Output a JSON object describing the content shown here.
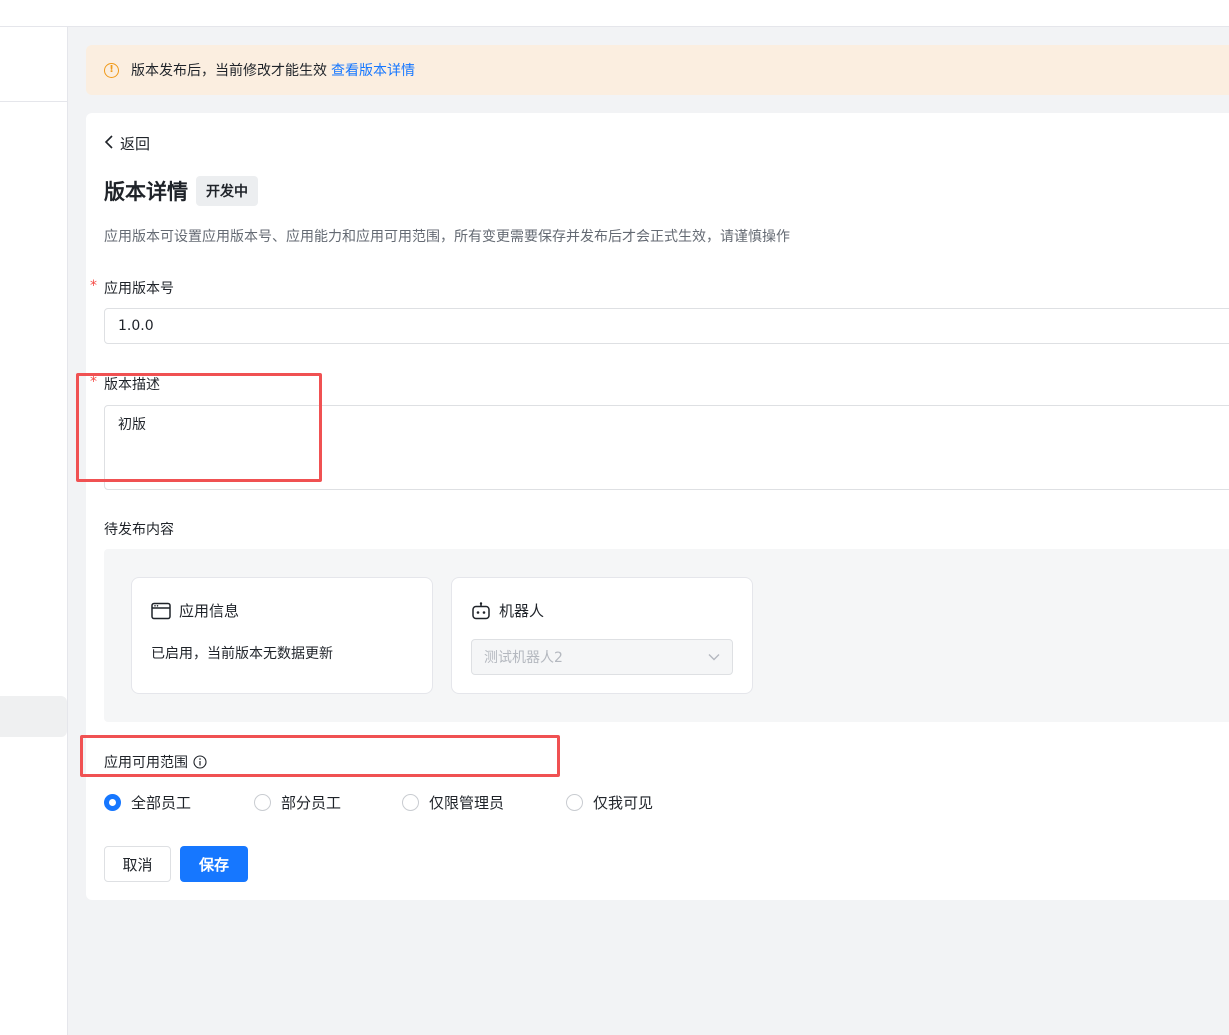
{
  "alert": {
    "icon": "info-circle-icon",
    "text": "版本发布后，当前修改才能生效",
    "link": "查看版本详情"
  },
  "back": {
    "label": "返回"
  },
  "header": {
    "title": "版本详情",
    "status": "开发中",
    "description": "应用版本可设置应用版本号、应用能力和应用可用范围，所有变更需要保存并发布后才会正式生效，请谨慎操作"
  },
  "form": {
    "version_label": "应用版本号",
    "version_value": "1.0.0",
    "description_label": "版本描述",
    "description_value": "初版",
    "required_mark": "*"
  },
  "pending": {
    "label": "待发布内容",
    "app_info": {
      "title": "应用信息",
      "icon": "app-window-icon",
      "body": "已启用，当前版本无数据更新"
    },
    "robot": {
      "title": "机器人",
      "icon": "robot-icon",
      "selected": "测试机器人2"
    }
  },
  "scope": {
    "label": "应用可用范围",
    "options": [
      {
        "label": "全部员工",
        "checked": true
      },
      {
        "label": "部分员工",
        "checked": false
      },
      {
        "label": "仅限管理员",
        "checked": false
      },
      {
        "label": "仅我可见",
        "checked": false
      }
    ]
  },
  "actions": {
    "cancel": "取消",
    "save": "保存"
  },
  "colors": {
    "primary": "#1677ff",
    "alert_bg": "#fbeee0",
    "required": "#f54a45",
    "highlight": "#f05152"
  }
}
